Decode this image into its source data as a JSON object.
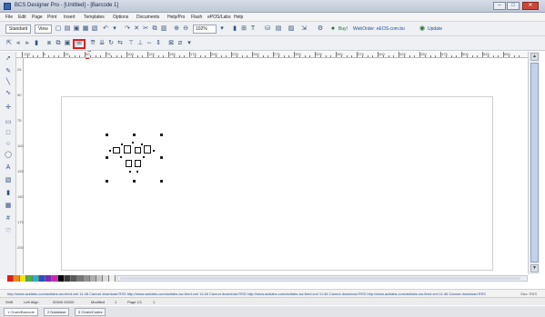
{
  "window": {
    "title": "BCS Designer Pro - [Untitled] - [Barcode 1]",
    "buttons": {
      "minimize": "–",
      "maximize": "□",
      "close": "✕"
    }
  },
  "menu": {
    "items": [
      "File",
      "Edit",
      "Page",
      "Print",
      "Insert",
      "Templates",
      "Options",
      "Documents",
      "Help/Pro",
      "Flash",
      "ePOS/Labs",
      "Help"
    ]
  },
  "toolbar1": {
    "standard_label": "Standard",
    "view_label": "View",
    "zoom_value": "102%",
    "link_green": "Buy!",
    "link_blue": "WebOrder: eEOS.com.bo",
    "link_blue2": "Update"
  },
  "ruler": {
    "top_numbers": [
      "-150",
      "0",
      "25",
      "50",
      "75",
      "100",
      "125",
      "150",
      "175",
      "200",
      "225",
      "250",
      "275",
      "300",
      "325",
      "350",
      "375",
      "400",
      "425",
      "450",
      "475",
      "500",
      "525",
      "550"
    ],
    "left_numbers": [
      "25",
      "50",
      "75",
      "100",
      "125",
      "150",
      "175",
      "200"
    ]
  },
  "palette": {
    "colors": [
      "#e21d1d",
      "#e98a1c",
      "#f1e21c",
      "#49b443",
      "#1fb6c6",
      "#2b4fc7",
      "#7a2bb5",
      "#c42bae",
      "#000000",
      "#3a3a3a",
      "#5a5a5a",
      "#777777",
      "#939393",
      "#adadad",
      "#c6c6c6",
      "#dcdcdc",
      "#efefef"
    ]
  },
  "status": {
    "ticker": "http://www.acklabs.com/actlabs-sw-feed.xml   11:46 Cannot download RSS  http://www.acklabs.com/actlabs-sw-feed.xml   11:46 Cannot download RSS  http://www.acklabs.com/actlabs-sw-feed.xml   11:46 Cannot download RSS  http://www.acklabs.com/actlabs-sw-feed.xml   11:46 Cannot download RSS",
    "extra": "Xlsx: RSS",
    "cells": [
      "Shift",
      "Left Align",
      "00940 00200",
      "Modified",
      "1",
      "Page 1/1",
      "1"
    ]
  },
  "tabs": [
    "1 Chain/Barcode",
    "2 Database",
    "3 Chain/Codes"
  ]
}
